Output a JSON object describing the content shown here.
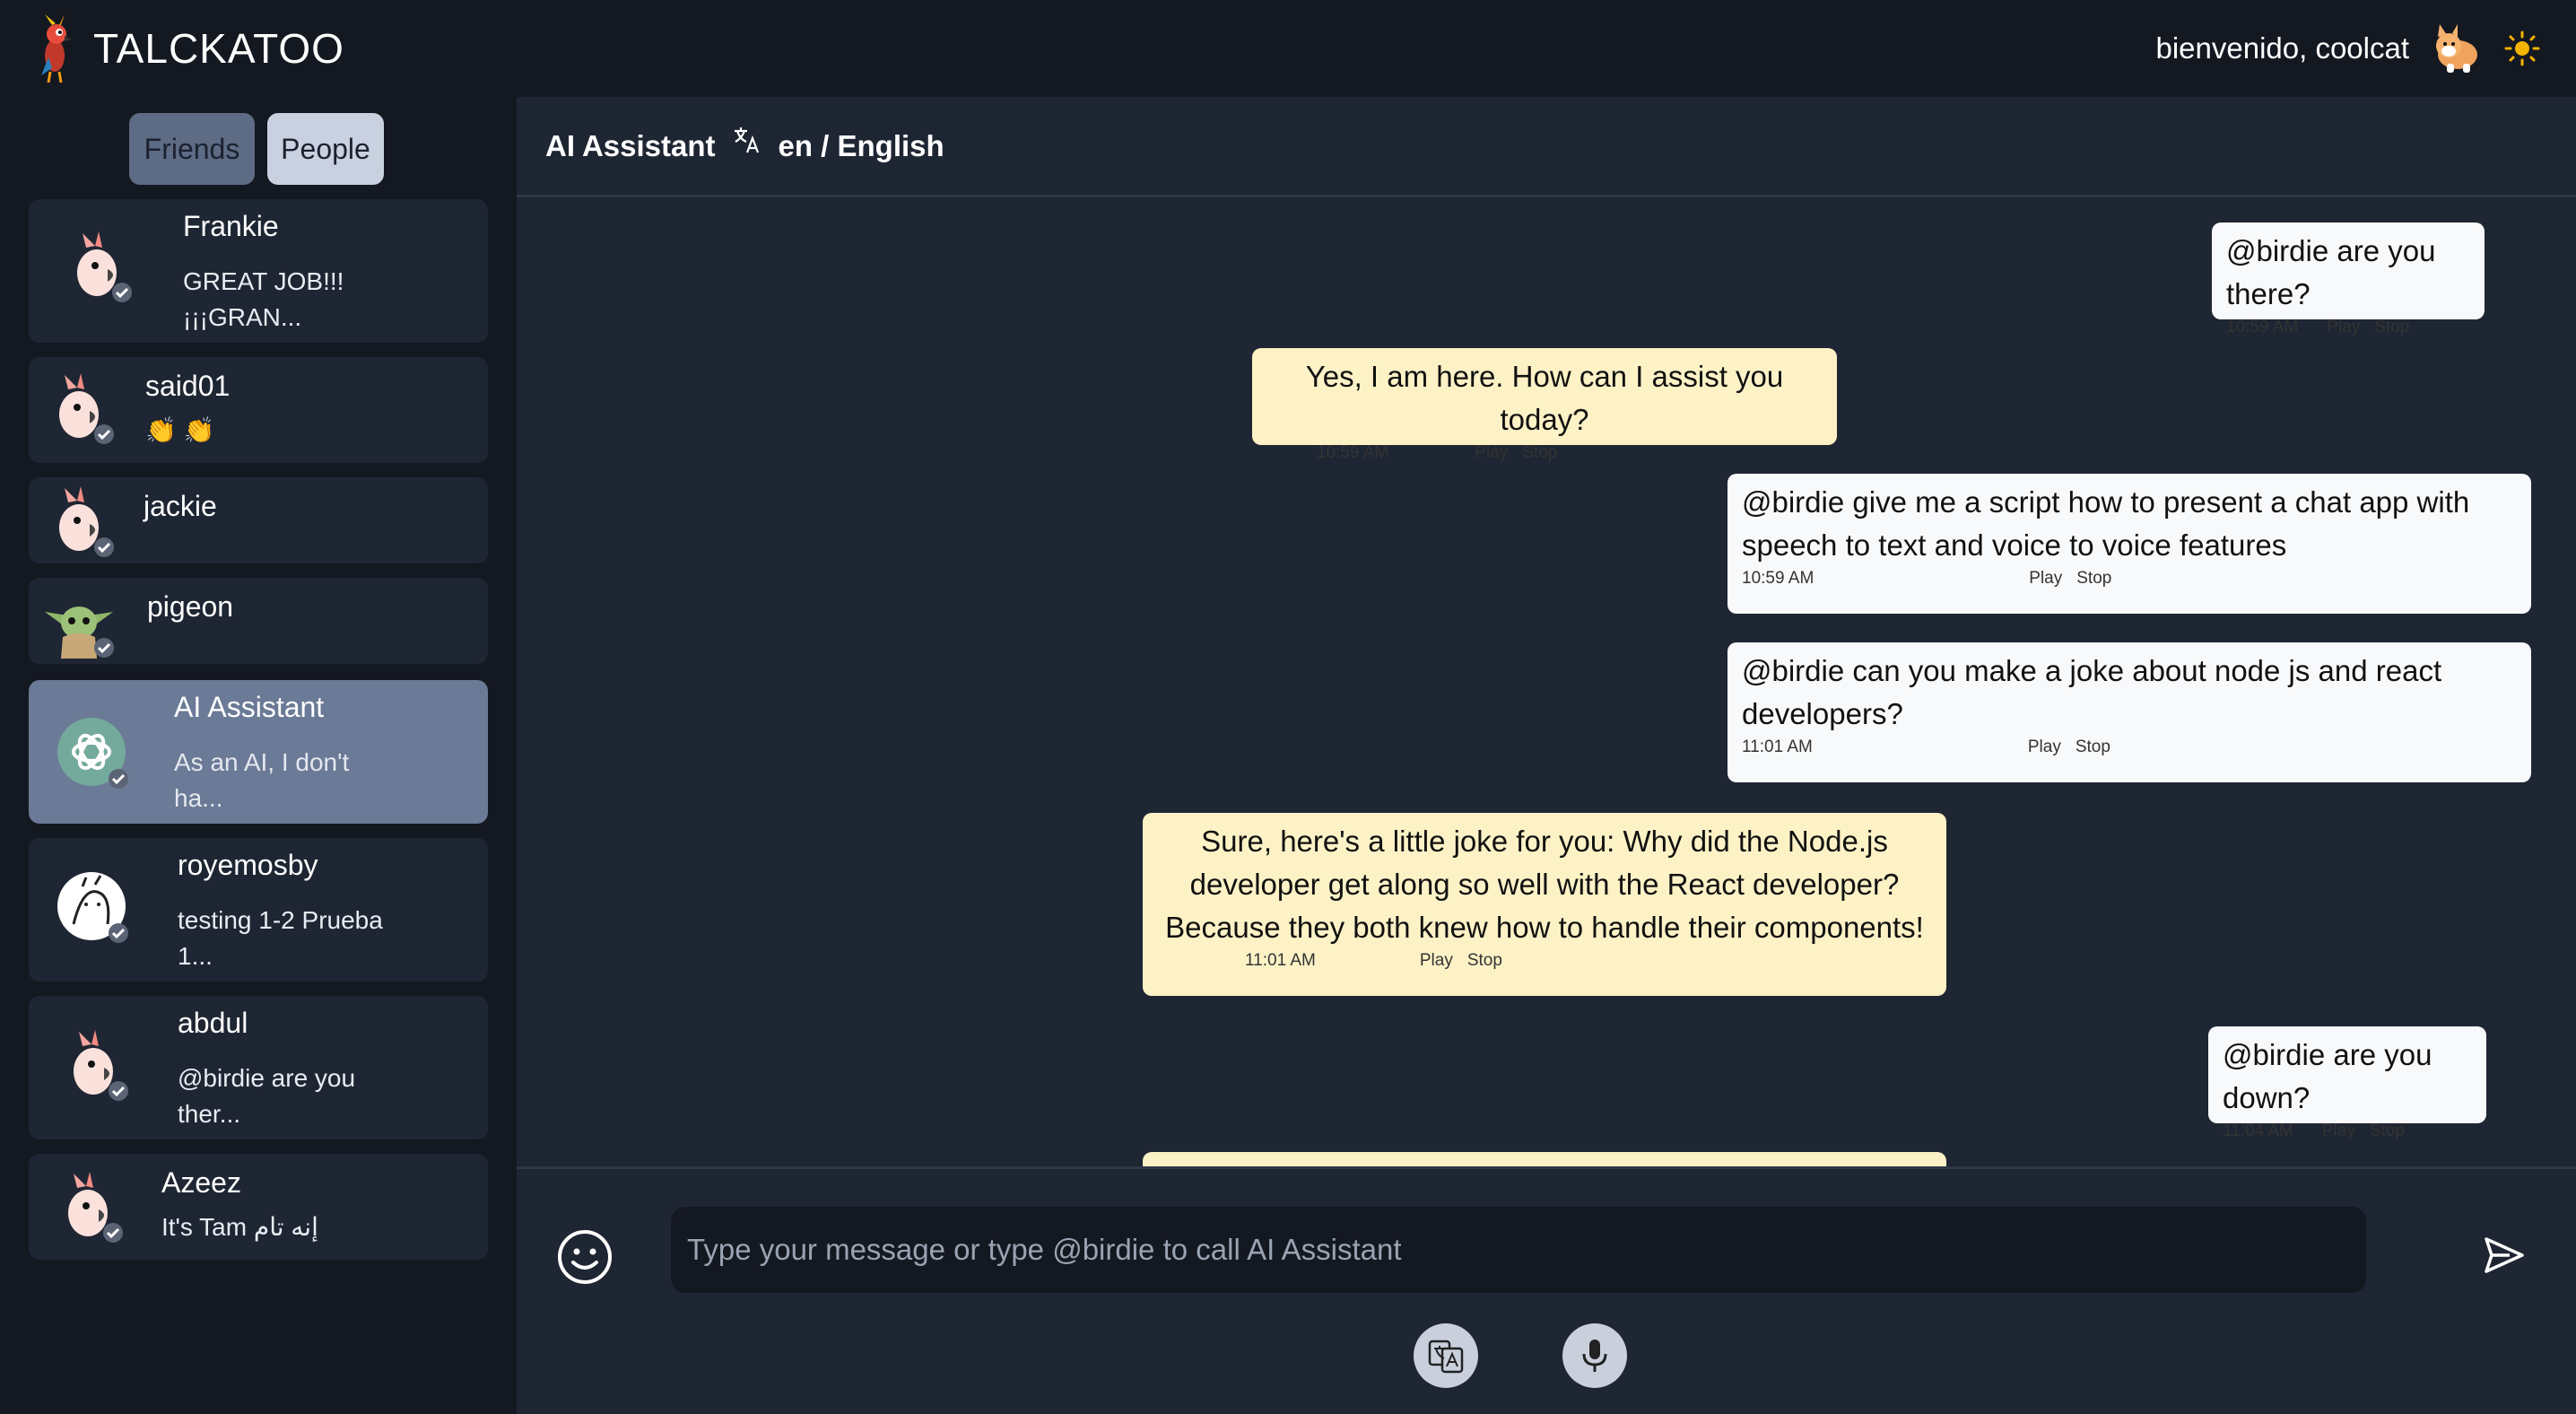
{
  "app": {
    "name": "TALCKATOO",
    "welcome": "bienvenido, coolcat"
  },
  "tabs": [
    {
      "label": "Friends"
    },
    {
      "label": "People"
    }
  ],
  "contacts": [
    {
      "name": "Frankie",
      "last": "GREAT JOB!!! ¡¡¡GRAN...",
      "avatar": "cockatoo-avatar"
    },
    {
      "name": "said01",
      "last": "👏 👏",
      "avatar": "cockatoo-avatar"
    },
    {
      "name": "jackie",
      "last": "",
      "avatar": "cockatoo-avatar"
    },
    {
      "name": "pigeon",
      "last": "",
      "avatar": "green-creature-avatar"
    },
    {
      "name": "AI Assistant",
      "last": "As an AI, I don't ha...",
      "avatar": "openai-logo-avatar",
      "active": true
    },
    {
      "name": "royemosby",
      "last": "testing 1-2 Prueba 1...",
      "avatar": "sketch-avatar"
    },
    {
      "name": "abdul",
      "last": "@birdie are you ther...",
      "avatar": "cockatoo-avatar"
    },
    {
      "name": "Azeez",
      "last": "It's Tam إنه تام",
      "avatar": "cockatoo-avatar"
    }
  ],
  "chat": {
    "title": "AI Assistant",
    "language": "en / English",
    "messages": [
      {
        "from": "me",
        "text": "@birdie are you there?",
        "time": "10:59 AM"
      },
      {
        "from": "ai",
        "text": "Yes, I am here. How can I assist you today?",
        "time": "10:59 AM"
      },
      {
        "from": "me",
        "text": "@birdie give me a script how to present a chat app with speech to text and voice to voice features",
        "time": "10:59 AM"
      },
      {
        "from": "me",
        "text": "@birdie can you make a joke about node js and react developers?",
        "time": "11:01 AM"
      },
      {
        "from": "ai",
        "text": "Sure, here's a little joke for you: Why did the Node.js developer get along so well with the React developer? Because they both knew how to handle their components!",
        "time": "11:01 AM"
      },
      {
        "from": "me",
        "text": "@birdie are you down?",
        "time": "11:04 AM"
      }
    ],
    "play_label": "Play",
    "stop_label": "Stop"
  },
  "composer": {
    "placeholder": "Type your message or type @birdie to call AI Assistant"
  },
  "icons": {
    "theme": "sun-icon",
    "emoji": "smiley-icon",
    "send": "send-icon",
    "translate": "translate-icon",
    "mic": "microphone-icon"
  },
  "colors": {
    "header_bg": "#141821",
    "main_bg": "#1f2633",
    "active_contact": "#6b7a96",
    "user_bubble": "#f8f9fb",
    "ai_bubble": "#fdf2c6"
  }
}
